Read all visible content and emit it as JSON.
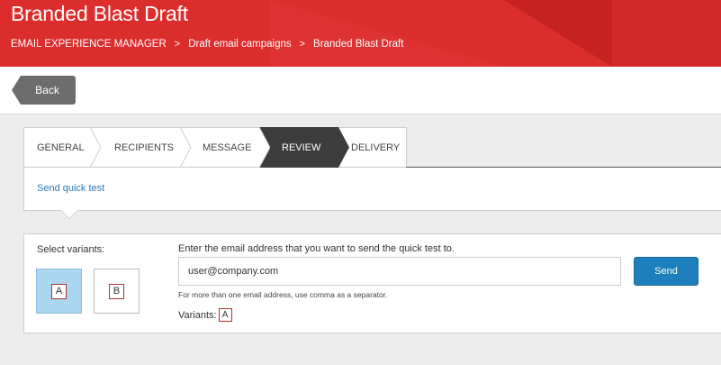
{
  "header": {
    "title": "Branded Blast Draft",
    "breadcrumbs": [
      {
        "label": "EMAIL EXPERIENCE MANAGER"
      },
      {
        "label": "Draft email campaigns"
      },
      {
        "label": "Branded Blast Draft"
      }
    ],
    "separator": ">",
    "color": "#dc2d2d"
  },
  "toolbar": {
    "back_label": "Back"
  },
  "tabs": [
    {
      "label": "GENERAL",
      "active": false
    },
    {
      "label": "RECIPIENTS",
      "active": false
    },
    {
      "label": "MESSAGE",
      "active": false
    },
    {
      "label": "REVIEW",
      "active": true
    },
    {
      "label": "DELIVERY",
      "active": false
    }
  ],
  "quick_test": {
    "link_label": "Send quick test"
  },
  "form": {
    "select_variants_label": "Select variants:",
    "variants": [
      {
        "label": "A",
        "selected": true
      },
      {
        "label": "B",
        "selected": false
      }
    ],
    "email_label": "Enter the email address that you want to send the quick test to.",
    "email_value": "user@company.com",
    "hint": "For more than one email address, use comma as a separator.",
    "variants_summary_label": "Variants:",
    "variants_summary_value": "A",
    "send_label": "Send"
  },
  "colors": {
    "accent": "#1d7fbb",
    "active_tab": "#3d3d3d",
    "selected_variant": "#aad7ef"
  }
}
